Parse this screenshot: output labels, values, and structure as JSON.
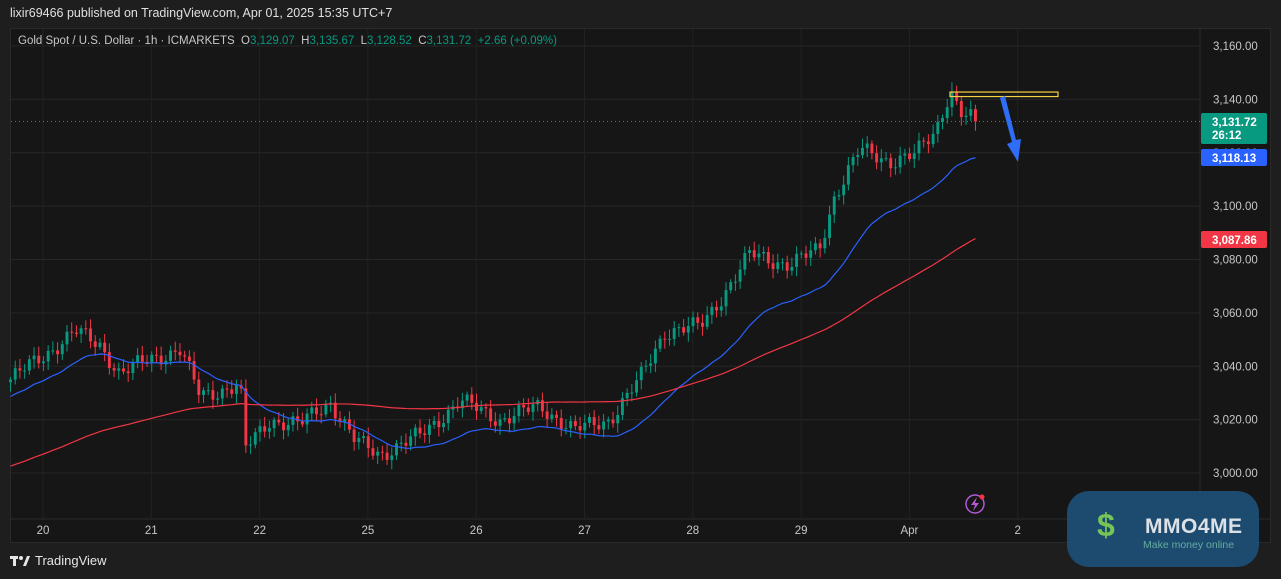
{
  "publish_line": "lixir69466 published on TradingView.com, Apr 01, 2025 15:35 UTC+7",
  "legend": {
    "symbol": "Gold Spot / U.S. Dollar · 1h · ICMARKETS",
    "o_label": "O",
    "o": "3,129.07",
    "h_label": "H",
    "h": "3,135.67",
    "l_label": "L",
    "l": "3,128.52",
    "c_label": "C",
    "c": "3,131.72",
    "change": "+2.66 (+0.09%)"
  },
  "price_labels": {
    "last": "3,131.72",
    "countdown": "26:12",
    "ema_fast": "3,118.13",
    "ema_slow": "3,087.86"
  },
  "footer": {
    "brand": "TradingView"
  },
  "watermark": {
    "title": "MMO4ME",
    "subtitle": "Make money online"
  },
  "colors": {
    "up": "#089981",
    "down": "#f23645",
    "ema_fast": "#2962ff",
    "ema_slow": "#f23645",
    "annotation": "#f5d142",
    "arrow": "#2f6df6"
  },
  "chart_data": {
    "type": "candlestick",
    "title": "Gold Spot / U.S. Dollar · 1h · ICMARKETS",
    "ylim": [
      2990,
      3166
    ],
    "yticks": [
      3000,
      3020,
      3040,
      3060,
      3080,
      3100,
      3120,
      3140,
      3160
    ],
    "ytick_labels": [
      "3,000.00",
      "3,020.00",
      "3,040.00",
      "3,060.00",
      "3,080.00",
      "3,100.00",
      "3,120.00",
      "3,140.00",
      "3,160.00"
    ],
    "xtick_labels": [
      "20",
      "21",
      "22",
      "25",
      "26",
      "27",
      "28",
      "29",
      "Apr",
      "2"
    ],
    "x_unit": "trading days from Mar 20",
    "close_path": [
      [
        -0.3,
        3035
      ],
      [
        0.07,
        3046
      ],
      [
        0.3,
        3053
      ],
      [
        0.53,
        3048
      ],
      [
        0.71,
        3037
      ],
      [
        0.99,
        3043
      ],
      [
        1.27,
        3046
      ],
      [
        1.45,
        3029
      ],
      [
        1.82,
        3033
      ],
      [
        1.87,
        3009
      ],
      [
        2.1,
        3020
      ],
      [
        2.37,
        3018
      ],
      [
        2.65,
        3027
      ],
      [
        2.88,
        3012
      ],
      [
        3.11,
        3007
      ],
      [
        3.48,
        3014
      ],
      [
        3.85,
        3027
      ],
      [
        4.22,
        3020
      ],
      [
        4.59,
        3025
      ],
      [
        4.91,
        3016
      ],
      [
        5.23,
        3020
      ],
      [
        5.51,
        3035
      ],
      [
        5.74,
        3053
      ],
      [
        6.07,
        3055
      ],
      [
        6.25,
        3065
      ],
      [
        6.53,
        3082
      ],
      [
        6.9,
        3078
      ],
      [
        7.17,
        3084
      ],
      [
        7.31,
        3104
      ],
      [
        7.54,
        3121
      ],
      [
        7.82,
        3117
      ],
      [
        8.05,
        3119
      ],
      [
        8.24,
        3128
      ],
      [
        8.38,
        3144
      ],
      [
        8.47,
        3135
      ],
      [
        8.61,
        3131.72
      ]
    ],
    "ema_fast_seed": 3028,
    "ema_slow_seed": 3002,
    "ema_fast_last": 3118.13,
    "ema_slow_last": 3087.86,
    "last_price": 3131.72,
    "annotation_level": 3142,
    "series": [
      {
        "name": "EMA fast"
      },
      {
        "name": "EMA slow"
      }
    ]
  }
}
